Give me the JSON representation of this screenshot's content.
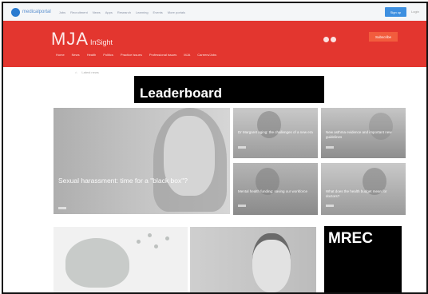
{
  "portal": {
    "logo_text": "medicalportal",
    "nav": [
      "Jobs",
      "Recruitment",
      "News",
      "Apps",
      "Research",
      "Learning",
      "Events",
      "More portals"
    ],
    "signup_label": "Sign up",
    "login_label": "Login"
  },
  "header": {
    "brand_main": "MJA",
    "brand_sub": "InSight",
    "subscribe_label": "Subscribe",
    "nav": [
      "Home",
      "News",
      "Health",
      "Politics",
      "Practice issues",
      "Professional issues",
      "MJA",
      "Careers/Jobs"
    ]
  },
  "breadcrumb": [
    "Home",
    "Latest news"
  ],
  "ads": {
    "leaderboard_label": "Leaderboard",
    "mrec_label": "MREC"
  },
  "articles": {
    "featured_title": "Sexual harassment: time for a \"black box\"?",
    "tile_1": "Dr Margaret aging: the challenges of a new era",
    "tile_2": "New asthma evidence and important new guidelines",
    "tile_3": "Mental health funding: saving our workforce",
    "tile_4": "What does the health budget mean for doctors?"
  },
  "colors": {
    "header_red": "#e3362f",
    "accent_blue": "#3d8fe0",
    "ad_black": "#000000"
  }
}
